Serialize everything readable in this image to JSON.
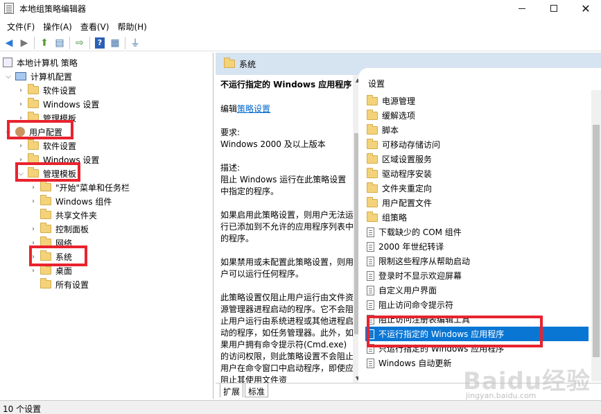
{
  "window": {
    "title": "本地组策略编辑器",
    "minimize_symbol": "",
    "maximize_symbol": "",
    "close_symbol": "✕"
  },
  "menu": {
    "items": [
      "文件(F)",
      "操作(A)",
      "查看(V)",
      "帮助(H)"
    ]
  },
  "toolbar": {
    "back": "◀",
    "forward": "▶",
    "up": "⬆",
    "show_hide": "▤",
    "export": "⇨",
    "help": "?",
    "properties": "▦",
    "filter": "⏚"
  },
  "tree": {
    "root": "本地计算机 策略",
    "computer_config": "计算机配置",
    "cc_software": "软件设置",
    "cc_windows": "Windows 设置",
    "cc_admin": "管理模板",
    "user_config": "用户配置",
    "uc_software": "软件设置",
    "uc_windows": "Windows 设置",
    "uc_admin": "管理模板",
    "start_menu": "\"开始\"菜单和任务栏",
    "win_components": "Windows 组件",
    "shared_folders": "共享文件夹",
    "control_panel": "控制面板",
    "network": "网络",
    "system": "系统",
    "desktop": "桌面",
    "all_settings": "所有设置"
  },
  "right": {
    "header": "系统",
    "list_header": "设置",
    "desc": {
      "title": "不运行指定的 Windows 应用程序",
      "edit_prefix": "编辑",
      "edit_link": "策略设置",
      "req_label": "要求:",
      "req_value": "Windows 2000 及以上版本",
      "desc_label": "描述:",
      "desc_value": "阻止 Windows 运行在此策略设置中指定的程序。",
      "p_enabled": "如果启用此策略设置，则用户无法运行已添加到不允许的应用程序列表中的程序。",
      "p_disabled": "如果禁用或未配置此策略设置，则用户可以运行任何程序。",
      "p_note": "此策略设置仅阻止用户运行由文件资源管理器进程启动的程序。它不会阻止用户运行由系统进程或其他进程启动的程序，如任务管理器。此外，如果用户拥有命令提示符(Cmd.exe)的访问权限，则此策略设置不会阻止用户在命令窗口中启动程序，即使应阻止其使用文件资"
    },
    "items": [
      {
        "label": "电源管理",
        "kind": "folder"
      },
      {
        "label": "缓解选项",
        "kind": "folder"
      },
      {
        "label": "脚本",
        "kind": "folder"
      },
      {
        "label": "可移动存储访问",
        "kind": "folder"
      },
      {
        "label": "区域设置服务",
        "kind": "folder"
      },
      {
        "label": "驱动程序安装",
        "kind": "folder"
      },
      {
        "label": "文件夹重定向",
        "kind": "folder"
      },
      {
        "label": "用户配置文件",
        "kind": "folder"
      },
      {
        "label": "组策略",
        "kind": "folder"
      },
      {
        "label": "下载缺少的 COM 组件",
        "kind": "setting"
      },
      {
        "label": "2000 年世纪转译",
        "kind": "setting"
      },
      {
        "label": "限制这些程序从帮助启动",
        "kind": "setting"
      },
      {
        "label": "登录时不显示欢迎屏幕",
        "kind": "setting"
      },
      {
        "label": "自定义用户界面",
        "kind": "setting"
      },
      {
        "label": "阻止访问命令提示符",
        "kind": "setting"
      },
      {
        "label": "阻止访问注册表编辑工具",
        "kind": "setting"
      },
      {
        "label": "不运行指定的 Windows 应用程序",
        "kind": "setting"
      },
      {
        "label": "只运行指定的 Windows 应用程序",
        "kind": "setting"
      },
      {
        "label": "Windows 自动更新",
        "kind": "setting"
      }
    ],
    "selected_index": 16,
    "tabs": [
      "扩展",
      "标准"
    ]
  },
  "status": {
    "text": "10 个设置"
  },
  "watermark": {
    "logo": "Baidu经验",
    "url": "jingyan.baidu.com"
  },
  "colors": {
    "highlight": "#e8232e",
    "selection": "#0a76d4",
    "header_bg": "#d6e3f0"
  }
}
